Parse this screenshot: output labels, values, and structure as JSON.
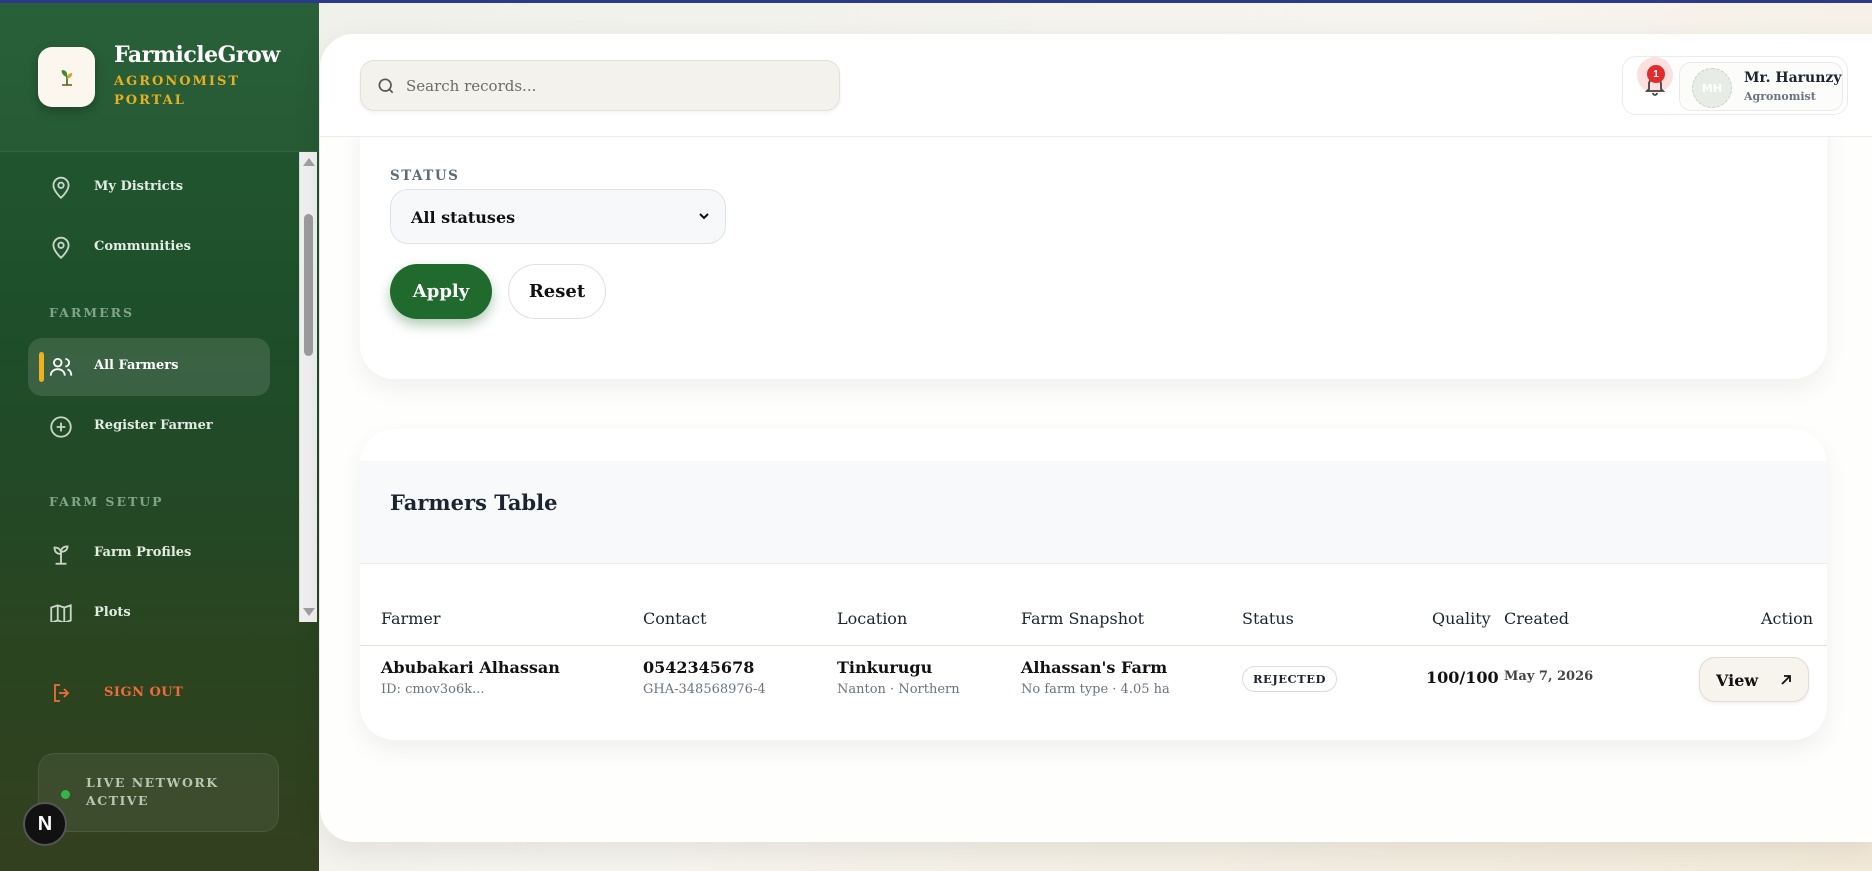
{
  "brand": {
    "name": "FarmicleGrow",
    "subtitle": "AGRONOMIST PORTAL"
  },
  "sidebar": {
    "items": [
      {
        "label": "My Districts",
        "icon": "map-pin-icon"
      },
      {
        "label": "Communities",
        "icon": "map-pin-icon"
      },
      {
        "label": "All Farmers",
        "icon": "users-icon",
        "active": true
      },
      {
        "label": "Register Farmer",
        "icon": "plus-circle-icon"
      },
      {
        "label": "Farm Profiles",
        "icon": "sprout-icon"
      },
      {
        "label": "Plots",
        "icon": "map-icon"
      }
    ],
    "sections": {
      "farmers": "FARMERS",
      "farm_setup": "FARM SETUP"
    },
    "sign_out": "SIGN OUT",
    "network_status": "LIVE NETWORK ACTIVE",
    "n_badge": "N"
  },
  "header": {
    "search_placeholder": "Search records...",
    "notification_count": "1",
    "user": {
      "initials": "MH",
      "name": "Mr. Harunzy",
      "role": "Agronomist"
    }
  },
  "filters": {
    "status_label": "STATUS",
    "status_value": "All statuses",
    "apply": "Apply",
    "reset": "Reset"
  },
  "table": {
    "title": "Farmers Table",
    "columns": [
      "Farmer",
      "Contact",
      "Location",
      "Farm Snapshot",
      "Status",
      "Quality",
      "Created",
      "Action"
    ],
    "rows": [
      {
        "farmer_name": "Abubakari Alhassan",
        "farmer_id": "ID: cmov3o6k...",
        "contact_phone": "0542345678",
        "contact_card": "GHA-348568976-4",
        "location_town": "Tinkurugu",
        "location_region": "Nanton · Northern",
        "farm_name": "Alhassan's Farm",
        "farm_detail": "No farm type · 4.05 ha",
        "status": "REJECTED",
        "quality": "100/100",
        "created": "May 7, 2026",
        "action": "View"
      }
    ]
  },
  "colors": {
    "sidebar_green": "#225b33",
    "accent_gold": "#f0b21c",
    "primary_green": "#1f6a2c",
    "sign_out": "#ef6b3c",
    "alert_red": "#e02c2c"
  }
}
